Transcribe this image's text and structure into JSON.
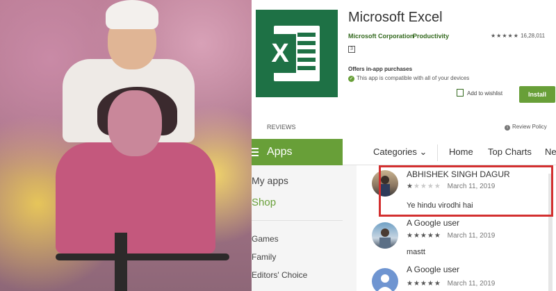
{
  "app": {
    "title": "Microsoft Excel",
    "developer": "Microsoft Corporation",
    "category": "Productivity",
    "rating_stars": "★★★★★",
    "rating_count": "16,28,011",
    "content_rating_icon": "3",
    "offers": "Offers in-app purchases",
    "compatibility": "This app is compatible with all of your devices",
    "wishlist": "Add to wishlist",
    "install": "Install",
    "reviews_label": "REVIEWS",
    "review_policy": "Review Policy"
  },
  "store": {
    "apps_label": "Apps",
    "nav": {
      "categories": "Categories ⌄",
      "home": "Home",
      "top_charts": "Top Charts",
      "new": "New"
    },
    "sidebar": [
      "My apps",
      "Shop",
      "Games",
      "Family",
      "Editors' Choice"
    ]
  },
  "reviews": [
    {
      "name": "ABHISHEK SINGH DAGUR",
      "stars_filled": "★",
      "stars_empty": "★★★★",
      "date": "March 11, 2019",
      "text": "Ye hindu virodhi hai"
    },
    {
      "name": "A Google user",
      "stars_filled": "★★★★★",
      "stars_empty": "",
      "date": "March 11, 2019",
      "text": "mastt"
    },
    {
      "name": "A Google user",
      "stars_filled": "★★★★★",
      "stars_empty": "",
      "date": "March 11, 2019",
      "text": ""
    }
  ]
}
